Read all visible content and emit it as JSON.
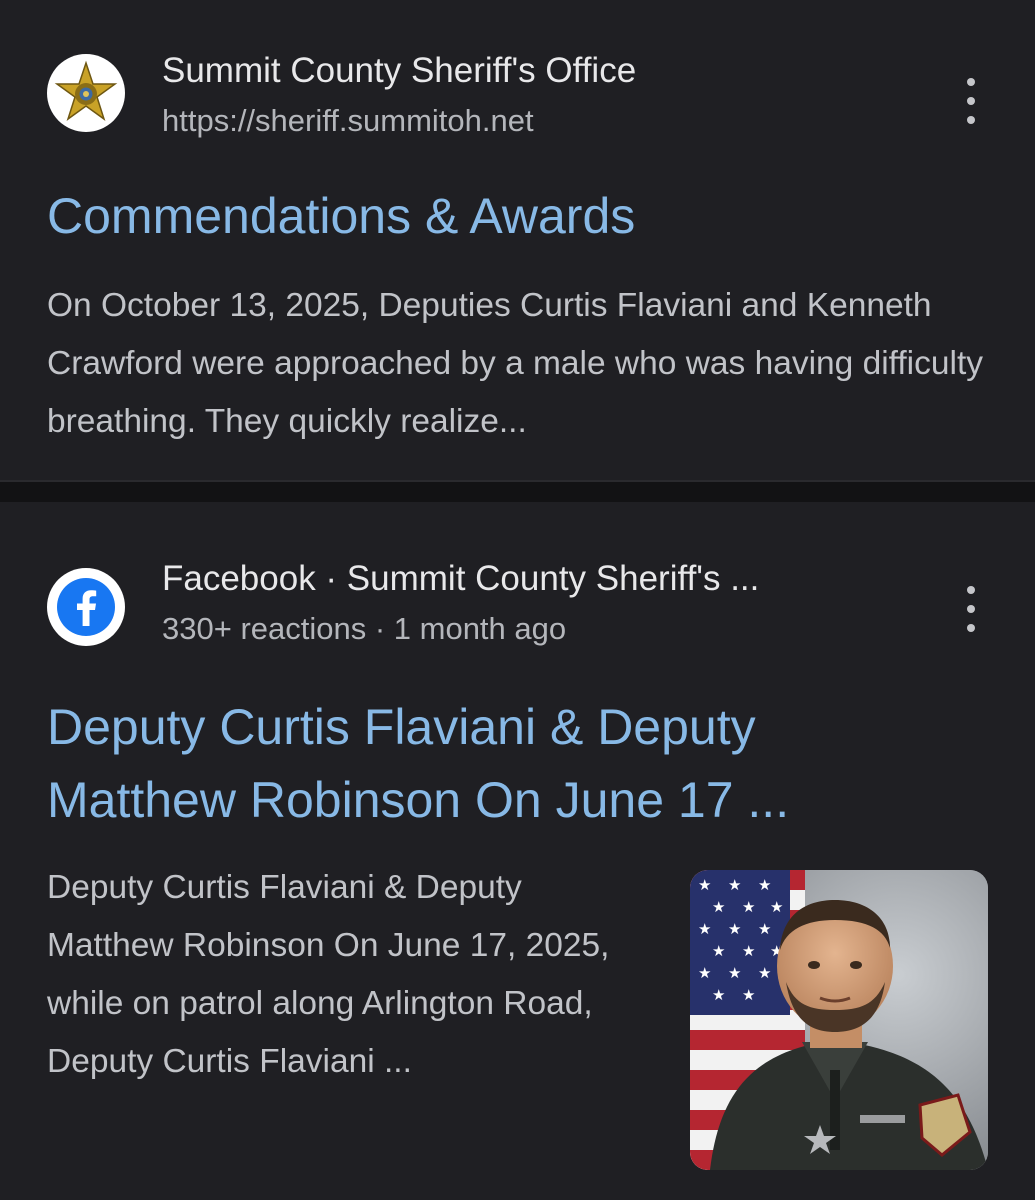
{
  "results": [
    {
      "source": {
        "icon": "sheriff-star-badge",
        "name": "Summit County Sheriff's Office",
        "meta": "https://sheriff.summitoh.net"
      },
      "title": "Commendations & Awards",
      "snippet": "On October 13, 2025, Deputies Curtis Flaviani and Kenneth Crawford were approached by a male who was having difficulty breathing. They quickly realize..."
    },
    {
      "source": {
        "icon": "facebook-logo",
        "name": "Facebook · Summit County Sheriff's ...",
        "meta": "330+ reactions · 1 month ago"
      },
      "title": "Deputy Curtis Flaviani & Deputy Matthew Robinson On June 17 ...",
      "snippet": "Deputy Curtis Flaviani & Deputy Matthew Robinson On June 17, 2025, while on patrol along Arlington Road, Deputy Curtis Flaviani ...",
      "thumbnail": {
        "icon": "deputy-portrait-photo"
      }
    }
  ],
  "colors": {
    "background": "#1f1f23",
    "divider": "#121214",
    "link": "#88b9e6",
    "source_text": "#e8e8ea",
    "meta_text": "#b4b6bb",
    "snippet_text": "#c1c3c8",
    "facebook_blue": "#1877f2",
    "badge_gold": "#c9a227"
  }
}
